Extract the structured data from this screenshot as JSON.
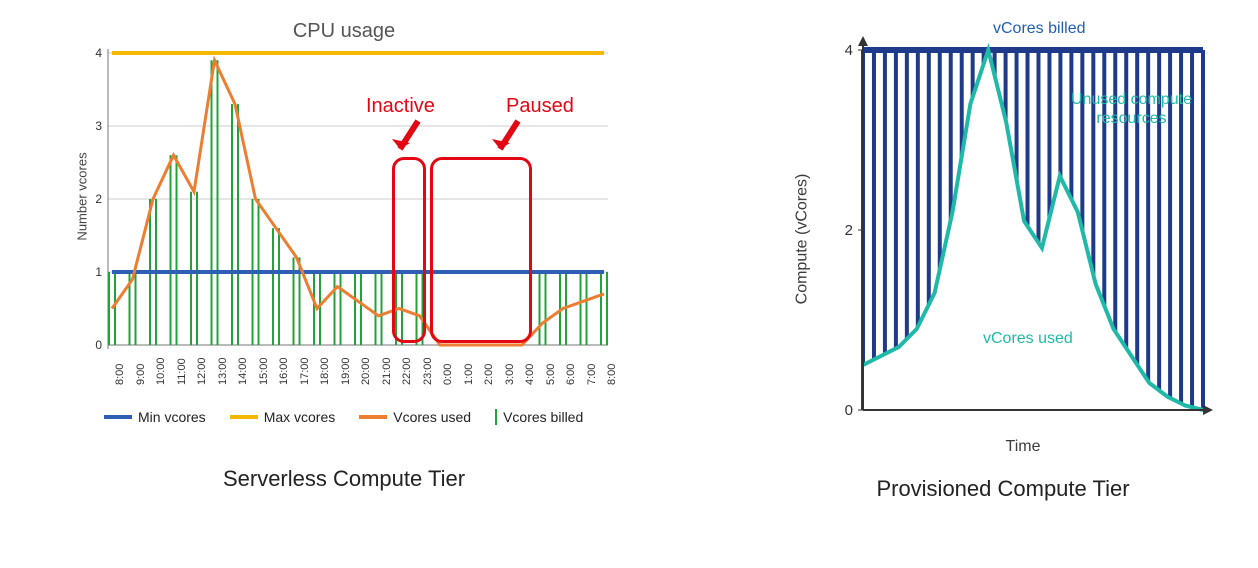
{
  "left_caption": "Serverless Compute Tier",
  "right_caption": "Provisioned Compute Tier",
  "chart_data": [
    {
      "type": "line",
      "title": "CPU usage",
      "ylabel": "Number vcores",
      "xlabel": "",
      "ylim": [
        0,
        4
      ],
      "categories": [
        "8:00",
        "9:00",
        "10:00",
        "11:00",
        "12:00",
        "13:00",
        "14:00",
        "15:00",
        "16:00",
        "17:00",
        "18:00",
        "19:00",
        "20:00",
        "21:00",
        "22:00",
        "23:00",
        "0:00",
        "1:00",
        "2:00",
        "3:00",
        "4:00",
        "5:00",
        "6:00",
        "7:00",
        "8:00"
      ],
      "series": [
        {
          "name": "Min vcores",
          "color": "#2f5fb5",
          "values": [
            1,
            1,
            1,
            1,
            1,
            1,
            1,
            1,
            1,
            1,
            1,
            1,
            1,
            1,
            1,
            1,
            1,
            1,
            1,
            1,
            1,
            1,
            1,
            1,
            1
          ]
        },
        {
          "name": "Max vcores",
          "color": "#f5b800",
          "values": [
            4,
            4,
            4,
            4,
            4,
            4,
            4,
            4,
            4,
            4,
            4,
            4,
            4,
            4,
            4,
            4,
            4,
            4,
            4,
            4,
            4,
            4,
            4,
            4,
            4
          ]
        },
        {
          "name": "Vcores used",
          "color": "#ed7d31",
          "values": [
            0.5,
            0.9,
            2.0,
            2.6,
            2.1,
            3.9,
            3.3,
            2.0,
            1.6,
            1.2,
            0.5,
            0.8,
            0.6,
            0.4,
            0.5,
            0.4,
            0.0,
            0.0,
            0.0,
            0.0,
            0.0,
            0.3,
            0.5,
            0.6,
            0.7
          ]
        }
      ],
      "bars": {
        "name": "Vcores billed",
        "color": "#21a33a",
        "values": [
          1.0,
          1.0,
          2.0,
          2.6,
          2.1,
          3.9,
          3.3,
          2.0,
          1.6,
          1.2,
          1.0,
          1.0,
          1.0,
          1.0,
          1.0,
          1.0,
          0.0,
          0.0,
          0.0,
          0.0,
          0.0,
          1.0,
          1.0,
          1.0,
          1.0
        ]
      },
      "annotations": [
        {
          "label": "Inactive",
          "x_range": [
            "22:00",
            "23:00"
          ]
        },
        {
          "label": "Paused",
          "x_range": [
            "0:00",
            "4:00"
          ]
        }
      ],
      "legend": [
        "Min vcores",
        "Max vcores",
        "Vcores used",
        "Vcores billed"
      ]
    },
    {
      "type": "area",
      "title": "",
      "ylabel": "Compute (vCores)",
      "xlabel": "Time",
      "ylim": [
        0,
        4
      ],
      "x": [
        0,
        1,
        2,
        3,
        4,
        5,
        6,
        7,
        8,
        9,
        10,
        11,
        12,
        13,
        14,
        15,
        16,
        17,
        18,
        19
      ],
      "series": [
        {
          "name": "vCores billed",
          "color": "#1e3a8a",
          "values": [
            4,
            4,
            4,
            4,
            4,
            4,
            4,
            4,
            4,
            4,
            4,
            4,
            4,
            4,
            4,
            4,
            4,
            4,
            4,
            4
          ]
        },
        {
          "name": "vCores used",
          "color": "#1fb9a8",
          "values": [
            0.5,
            0.6,
            0.7,
            0.9,
            1.3,
            2.2,
            3.4,
            4.0,
            3.2,
            2.1,
            1.8,
            2.6,
            2.2,
            1.4,
            0.9,
            0.6,
            0.3,
            0.15,
            0.05,
            0.0
          ]
        }
      ],
      "background_bars": {
        "color": "#203a8a",
        "count": 32,
        "height": 4
      },
      "annotations": [
        {
          "label": "vCores billed",
          "pos": "top",
          "color": "#1e5fb4"
        },
        {
          "label": "Unused compute resources",
          "pos": "upper-right",
          "color": "#1fb9a8"
        },
        {
          "label": "vCores used",
          "pos": "lower-mid",
          "color": "#1fb9a8"
        }
      ]
    }
  ],
  "left_legend": {
    "min": "Min vcores",
    "max": "Max vcores",
    "used": "Vcores used",
    "billed": "Vcores billed"
  },
  "left_annot": {
    "inactive": "Inactive",
    "paused": "Paused"
  },
  "right_annot": {
    "billed": "vCores billed",
    "unused1": "Unused compute",
    "unused2": "resources",
    "used": "vCores used"
  },
  "right_xlabel": "Time",
  "right_ylabel": "Compute (vCores)"
}
